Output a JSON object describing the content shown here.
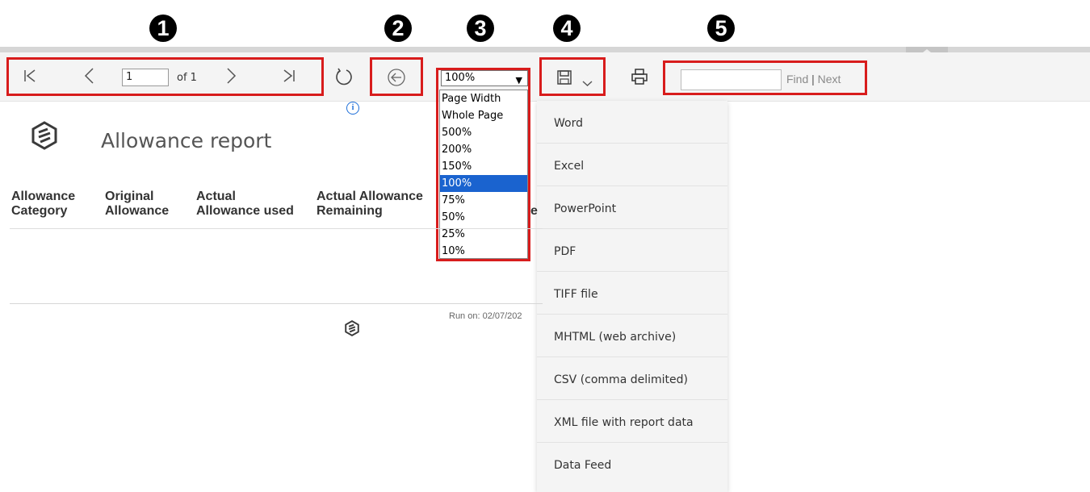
{
  "callouts": [
    "1",
    "2",
    "3",
    "4",
    "5"
  ],
  "toolbar": {
    "page_number": "1",
    "page_of": "of 1",
    "zoom_selected": "100%",
    "zoom_options": [
      "Page Width",
      "Whole Page",
      "500%",
      "200%",
      "150%",
      "100%",
      "75%",
      "50%",
      "25%",
      "10%"
    ],
    "find_label": "Find",
    "find_separator": "|",
    "next_label": "Next"
  },
  "icons": {
    "first_page": "first-page-icon",
    "prev_page": "previous-page-icon",
    "next_page": "next-page-icon",
    "last_page": "last-page-icon",
    "refresh": "refresh-icon",
    "back": "back-arrow-icon",
    "save": "save-icon",
    "print": "print-icon",
    "info": "info-icon",
    "logo": "company-logo-icon"
  },
  "export_menu": {
    "items": [
      "Word",
      "Excel",
      "PowerPoint",
      "PDF",
      "TIFF file",
      "MHTML (web archive)",
      "CSV (comma delimited)",
      "XML file with report data",
      "Data Feed"
    ]
  },
  "report": {
    "title": "Allowance report",
    "columns": [
      {
        "line1": "Allowance",
        "line2": "Category"
      },
      {
        "line1": "Original",
        "line2": "Allowance"
      },
      {
        "line1": "Actual",
        "line2": "Allowance used"
      },
      {
        "line1": "Actual Allowance",
        "line2": "Remaining"
      }
    ],
    "partial_column_fragment": "e",
    "run_on": "Run on:  02/07/202"
  },
  "colors": {
    "highlight_box": "#d81c1c",
    "selected_option": "#1a63cf",
    "info_blue": "#1e6fd9",
    "toolbar_bg": "#f4f4f4"
  }
}
